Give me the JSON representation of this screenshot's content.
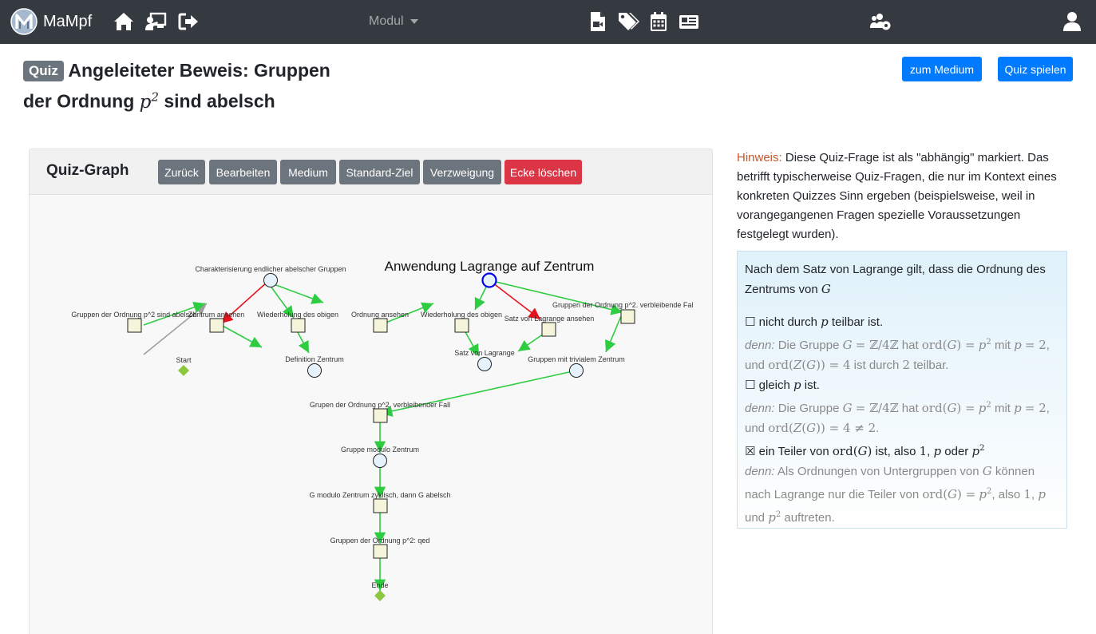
{
  "navbar": {
    "brand": "MaMpf",
    "modul_label": "Modul",
    "icons": [
      "home-icon",
      "teacher-screen-icon",
      "sign-out-icon",
      "file-video-icon",
      "tags-icon",
      "calendar-icon",
      "news-icon",
      "users-cog-icon",
      "user-icon"
    ]
  },
  "header": {
    "badge": "Quiz",
    "title_part1": "Angeleiteter Beweis: Gruppen der Ordnung",
    "title_math": "p",
    "title_exp": "2",
    "title_part2": "sind abelsch",
    "button_medium": "zum Medium",
    "button_play": "Quiz spielen"
  },
  "quiz_graph": {
    "title": "Quiz-Graph",
    "buttons": [
      "Zurück",
      "Bearbeiten",
      "Medium",
      "Standard-Ziel",
      "Verzweigung",
      "Ecke löschen"
    ],
    "selected_label": "Anwendung Lagrange auf Zentrum",
    "node_labels": {
      "charakterisierung": "Charakterisierung endlicher abelscher Gruppen",
      "gruppen_p2_abelsch": "Gruppen der Ordnung p^2 sind abelsch",
      "zentrum_ansehen": "Zentrum ansehen",
      "wiederholung1": "Wiederholung des obigen",
      "ordnung_ansehen": "Ordnung ansehen",
      "wiederholung2": "Wiederholung des obigen",
      "satz_lagrange_ansehen": "Satz von Lagrange ansehen",
      "gruppen_p2_verbleibende": "Gruppen der Ordnung p^2. verbleibende Fal",
      "start": "Start",
      "definition_zentrum": "Definition Zentrum",
      "satz_lagrange": "Satz von Lagrange",
      "trivialem_zentrum": "Gruppen mit trivialem Zentrum",
      "gruppen_verbleibender": "Grupen der Ordnung p^2. verbleibender Fall",
      "modulo_zentrum": "Gruppe modulo Zentrum",
      "zyklisch": "G modulo Zentrum zyklisch, dann G abelsch",
      "qed": "Gruppen der Ordnung p^2: qed",
      "ende": "Ende"
    }
  },
  "hint": {
    "label": "Hinweis:",
    "text": "Diese Quiz-Frage ist als \"abhängig\" markiert. Das betrifft typischerweise Quiz-Fragen, die nur im Kontext eines konkreten Quizzes Sinn ergeben (beispielsweise, weil in vorangegangenen Fragen spezielle Voraussetzungen festgelegt wurden)."
  },
  "question": {
    "text": "Nach dem Satz von Lagrange gilt, dass die Ordnung des Zentrums von",
    "var": "G"
  },
  "colors": {
    "navbar": "#343a40",
    "primary": "#007bff",
    "secondary": "#6c757d",
    "danger": "#dc3545",
    "edge_green": "#2ecc40",
    "edge_red": "#e8121d",
    "edge_grey": "#9e9e9e",
    "node_fill": "#f5f5dc",
    "selected_node": "#0000ee",
    "hint_label": "#c8572c"
  }
}
